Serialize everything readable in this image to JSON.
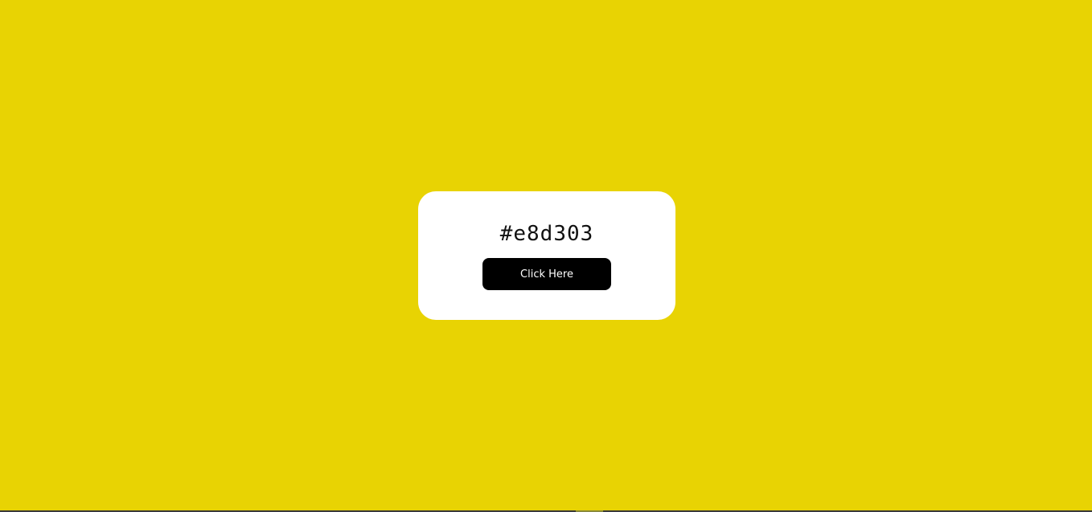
{
  "page": {
    "background_color": "#e8d303"
  },
  "card": {
    "color_code": "#e8d303",
    "button_label": "Click Here"
  },
  "colors": {
    "card_background": "#ffffff",
    "button_background": "#000000",
    "button_text": "#ffffff"
  }
}
